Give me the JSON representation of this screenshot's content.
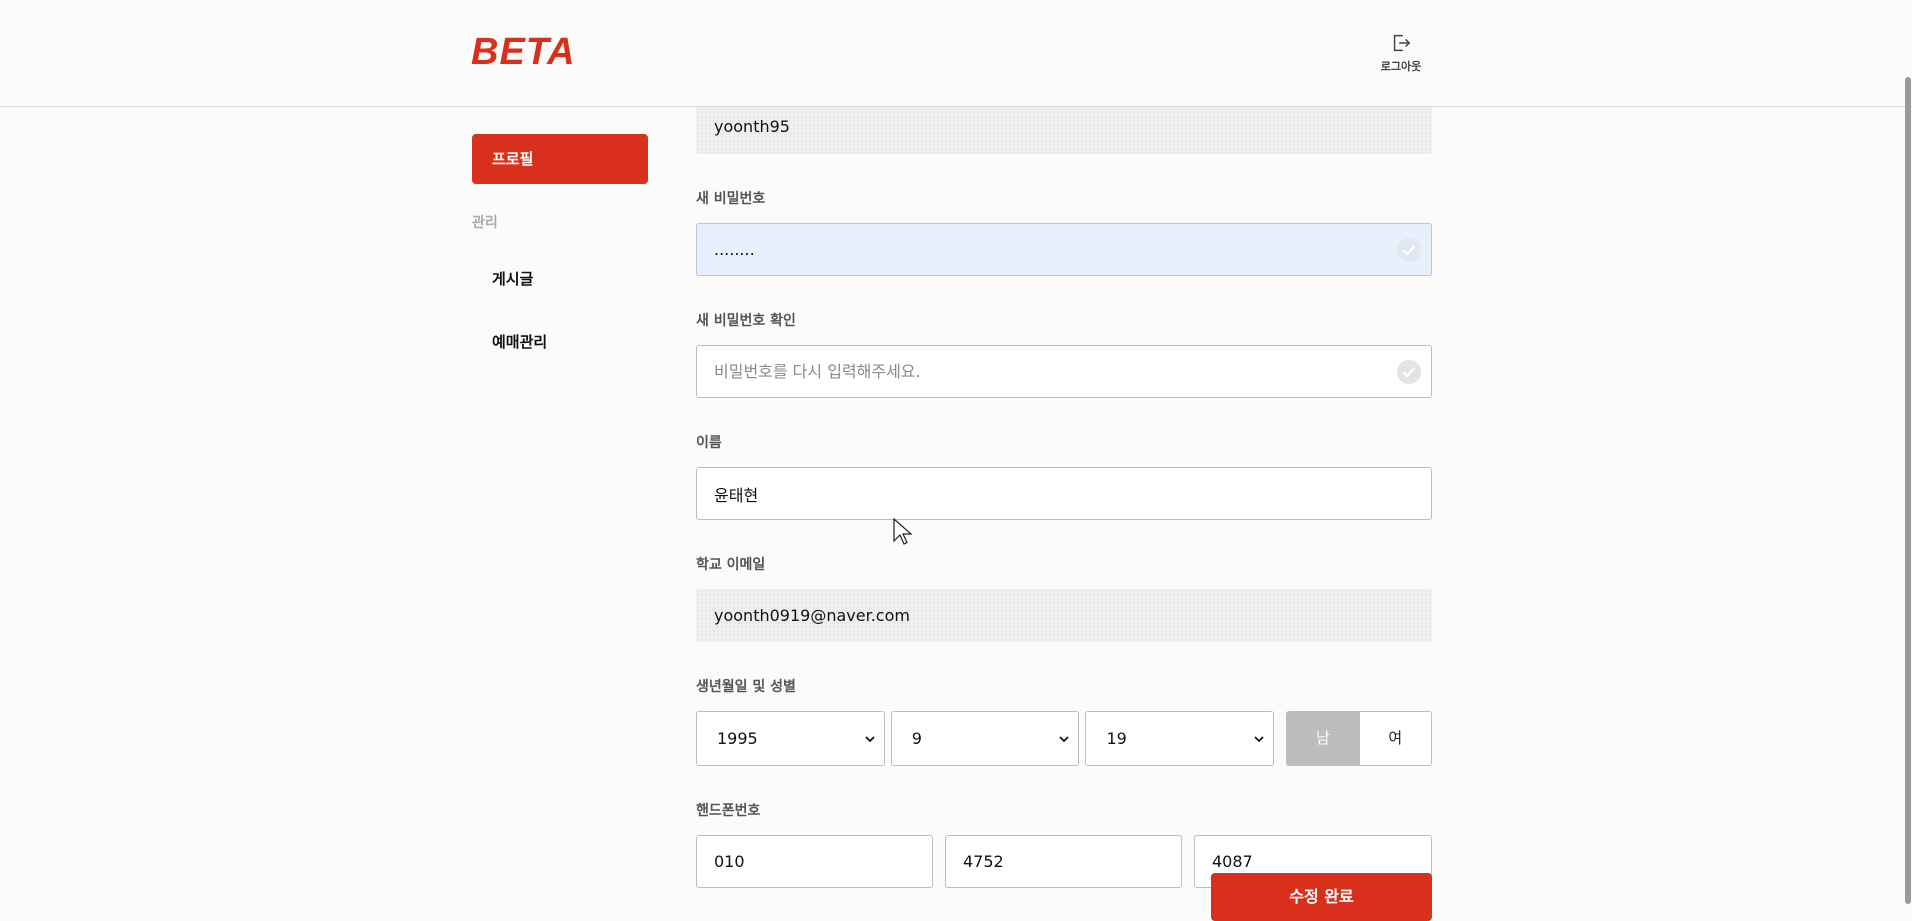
{
  "header": {
    "logo": "BETA",
    "logout_label": "로그아웃"
  },
  "sidebar": {
    "active_item": "프로필",
    "section_title": "관리",
    "items": [
      {
        "label": "게시글"
      },
      {
        "label": "예매관리"
      }
    ]
  },
  "form": {
    "user_id": "yoonth95",
    "new_password": {
      "label": "새 비밀번호",
      "value": "........"
    },
    "confirm_password": {
      "label": "새 비밀번호 확인",
      "placeholder": "비밀번호를 다시 입력해주세요."
    },
    "name": {
      "label": "이름",
      "value": "윤태현"
    },
    "email": {
      "label": "학교 이메일",
      "value": "yoonth0919@naver.com"
    },
    "birth_gender": {
      "label": "생년월일 및 성별",
      "year": "1995",
      "month": "9",
      "day": "19",
      "gender_options": [
        "남",
        "여"
      ],
      "selected_gender": "남"
    },
    "phone": {
      "label": "핸드폰번호",
      "part1": "010",
      "part2": "4752",
      "part3": "4087"
    },
    "submit_label": "수정 완료"
  },
  "colors": {
    "accent": "#d9301d",
    "autofill": "#e8f0fe"
  }
}
